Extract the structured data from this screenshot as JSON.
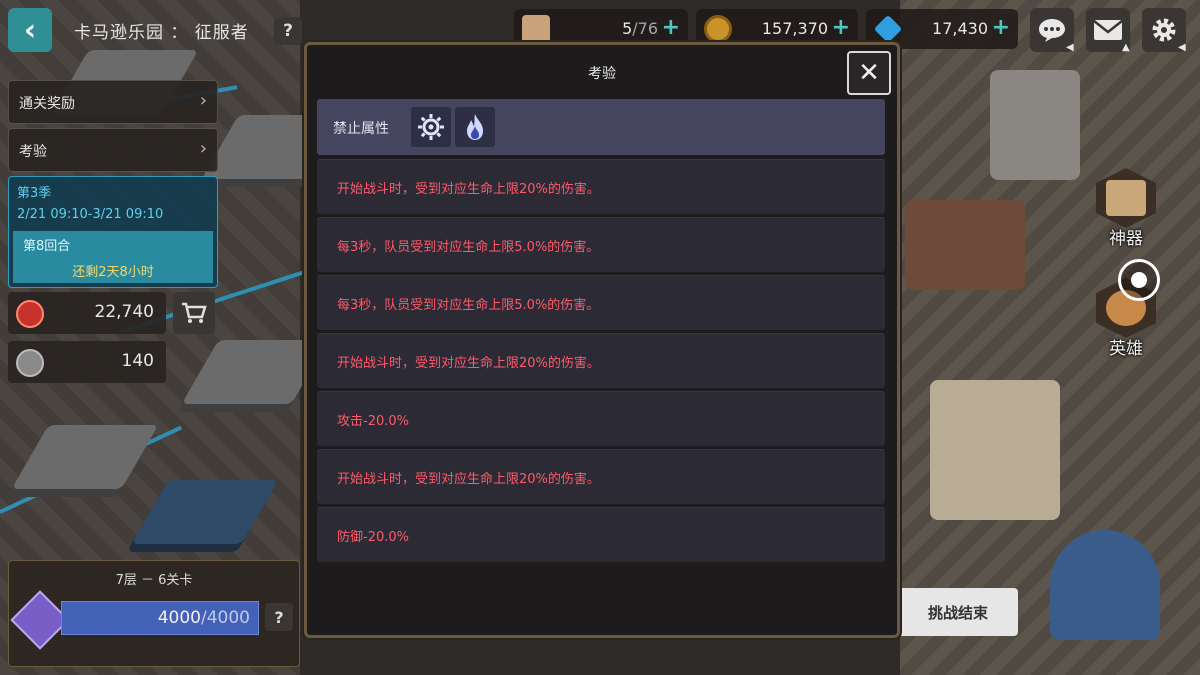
{
  "top_bar": {
    "title": "卡马逊乐园 ： 征服者",
    "help_label": "?",
    "stamina": {
      "current": "5",
      "max": "/76",
      "plus": "+"
    },
    "gold": {
      "value": "157,370",
      "plus": "+"
    },
    "gems": {
      "value": "17,430",
      "plus": "+"
    },
    "icons": [
      "coffee-cup-icon",
      "gold-coin-icon",
      "diamond-icon",
      "chat-icon",
      "mail-icon",
      "gear-icon"
    ]
  },
  "left_panel": {
    "clear_reward": "通关奖励",
    "trial": "考验",
    "season": {
      "name": "第3季",
      "period": "2/21 09:10-3/21 09:10",
      "round": "第8回合",
      "remaining": "还剩2天8小时"
    },
    "currency1": "22,740",
    "currency2": "140",
    "floor": {
      "label": "7层 － 6关卡",
      "current": "4000",
      "max": "/4000",
      "help": "?"
    }
  },
  "right_panel": {
    "artifact_label": "神器",
    "hero_label": "英雄",
    "end_challenge": "挑战结束"
  },
  "modal": {
    "title": "考验",
    "close": "✕",
    "banned_label": "禁止属性",
    "banned_icons": [
      "light-element-icon",
      "fire-element-icon"
    ],
    "rules": [
      "开始战斗时，受到对应生命上限20%的伤害。",
      "每3秒，队员受到对应生命上限5.0%的伤害。",
      "每3秒，队员受到对应生命上限5.0%的伤害。",
      "开始战斗时，受到对应生命上限20%的伤害。",
      "攻击-20.0%",
      "开始战斗时，受到对应生命上限20%的伤害。",
      "防御-20.0%"
    ]
  },
  "colors": {
    "accent_teal": "#2f8f95",
    "rule_text": "#ff5a6a",
    "banned_bg": "#454560",
    "season_text": "#5fd0ee",
    "remaining_text": "#f3d86b"
  }
}
